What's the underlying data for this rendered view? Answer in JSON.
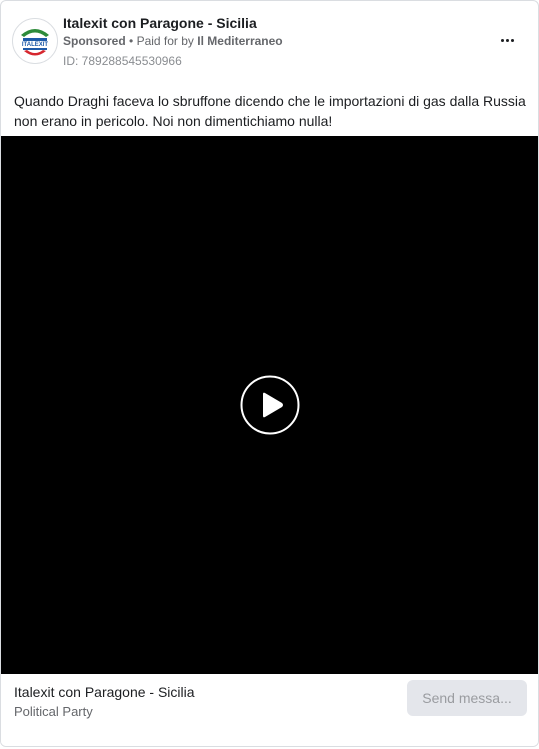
{
  "ad": {
    "page_name": "Italexit con Paragone - Sicilia",
    "sponsored_label": "Sponsored",
    "separator": "•",
    "paid_for_prefix": "Paid for by",
    "payer": "Il Mediterraneo",
    "id_text": "ID: 789288545530966",
    "more_icon": "more-horizontal-icon",
    "logo_text": "ITALEXIT",
    "body_text": "Quando Draghi faceva lo sbruffone dicendo che le importazioni di gas dalla Russia non erano in pericolo. Noi non dimentichiamo nulla!"
  },
  "video": {
    "background": "#000000",
    "play_icon": "play-icon"
  },
  "footer": {
    "title": "Italexit con Paragone - Sicilia",
    "subtitle": "Political Party",
    "cta_label": "Send messa..."
  },
  "colors": {
    "text_primary": "#1c1e21",
    "text_secondary": "#65676b",
    "button_bg": "#e4e6eb",
    "logo_green": "#2e8b3a",
    "logo_red": "#d6262e",
    "logo_blue": "#1e5aa8"
  }
}
